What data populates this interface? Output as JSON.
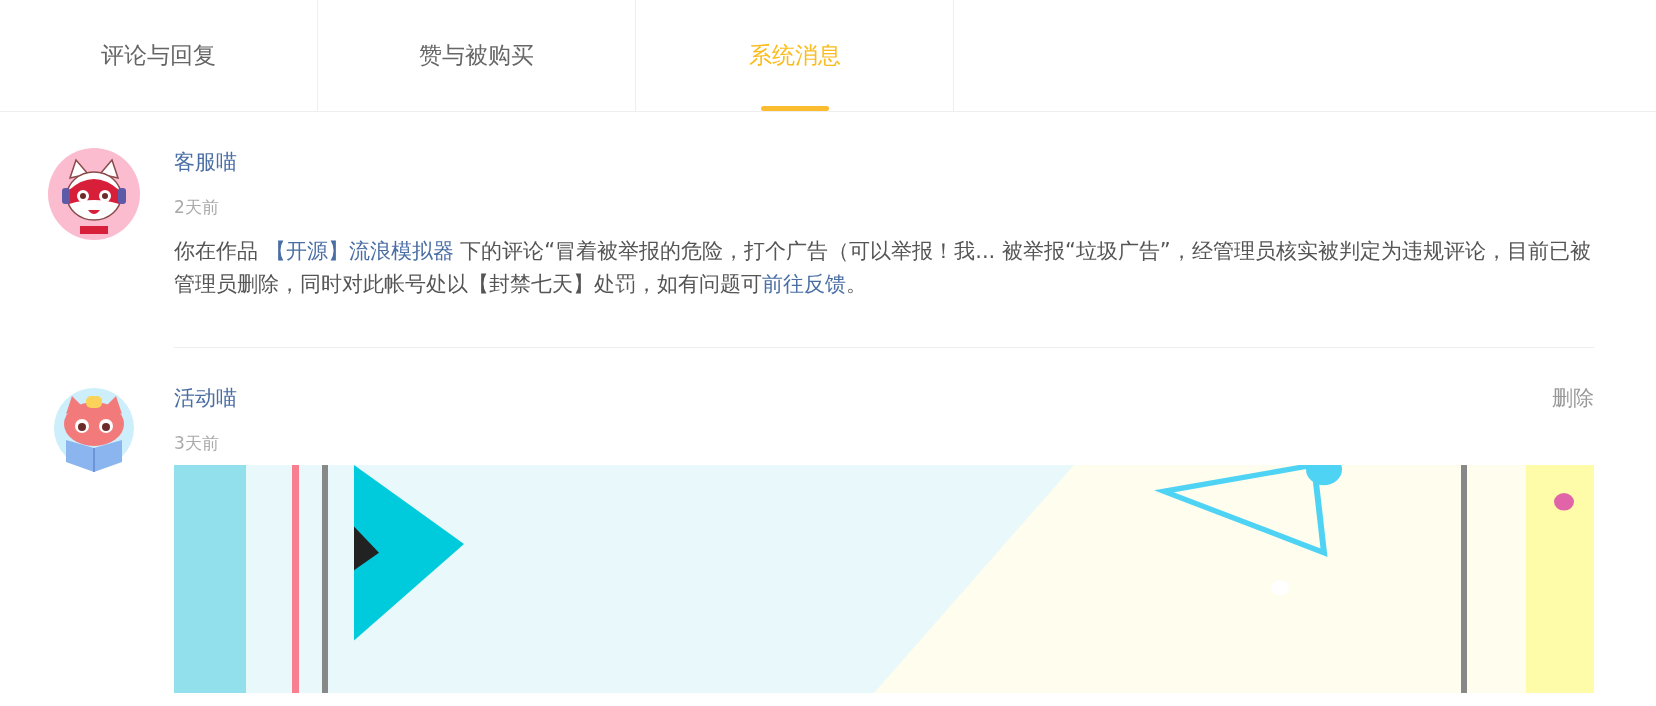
{
  "tabs": [
    {
      "label": "评论与回复",
      "selected": false
    },
    {
      "label": "赞与被购买",
      "selected": false
    },
    {
      "label": "系统消息",
      "selected": true
    }
  ],
  "messages": [
    {
      "sender": "客服喵",
      "time": "2天前",
      "kind": "notice",
      "body": [
        {
          "kind": "text",
          "text": "你在作品 "
        },
        {
          "kind": "link",
          "text": "【开源】流浪模拟器"
        },
        {
          "kind": "text",
          "text": " 下的评论“冒着被举报的危险，打个广告（可以举报！我... 被举报“垃圾广告”，经管理员核实被判定为违规评论，目前已被管理员删除，同时对此帐号处以【封禁七天】处罚，如有问题可"
        },
        {
          "kind": "link",
          "text": "前往反馈"
        },
        {
          "kind": "text",
          "text": "。"
        }
      ]
    },
    {
      "sender": "活动喵",
      "time": "3天前",
      "kind": "event",
      "action": "删除"
    }
  ]
}
